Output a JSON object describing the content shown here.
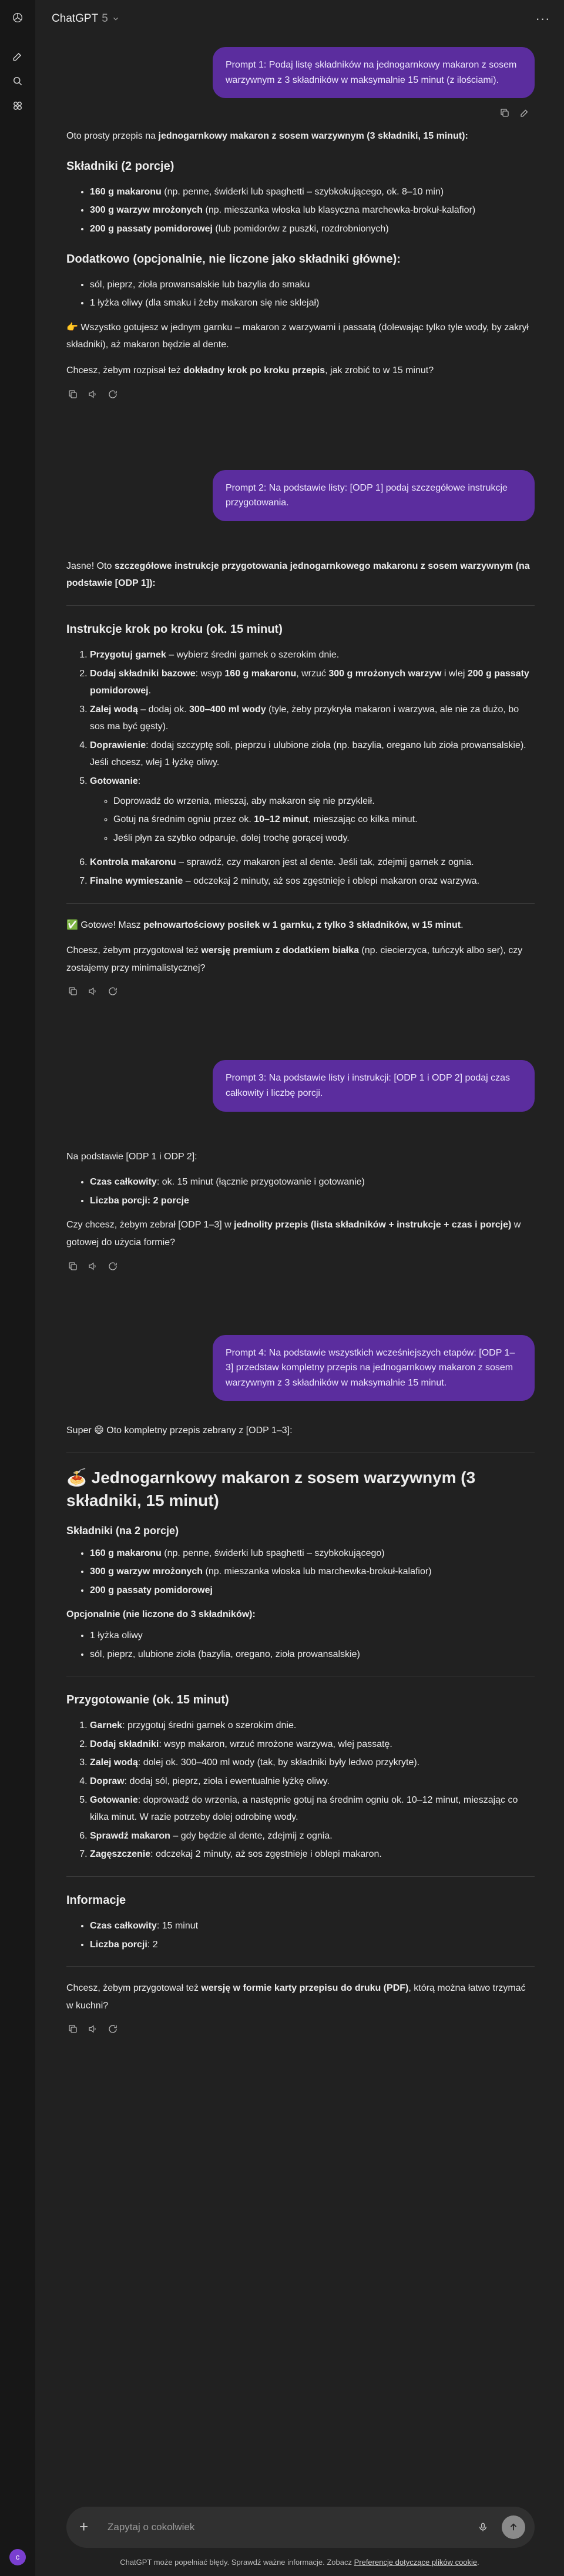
{
  "header": {
    "model_name": "ChatGPT",
    "model_version": "5"
  },
  "messages": {
    "p1": "Prompt 1: Podaj listę składników na jednogarnkowy makaron z sosem warzywnym z 3 składników w maksymalnie 15 minut (z ilościami).",
    "a1": {
      "intro_pre": "Oto prosty przepis na ",
      "intro_bold": "jednogarnkowy makaron z sosem warzywnym (3 składniki, 15 minut):",
      "h_ingredients": "Składniki (2 porcje)",
      "ing1_b": "160 g makaronu",
      "ing1_r": " (np. penne, świderki lub spaghetti – szybkokującego, ok. 8–10 min)",
      "ing2_b": "300 g warzyw mrożonych",
      "ing2_r": " (np. mieszanka włoska lub klasyczna marchewka-brokuł-kalafior)",
      "ing3_b": "200 g passaty pomidorowej",
      "ing3_r": " (lub pomidorów z puszki, rozdrobnionych)",
      "h_extra": "Dodatkowo (opcjonalnie, nie liczone jako składniki główne):",
      "extra1": "sól, pieprz, zioła prowansalskie lub bazylia do smaku",
      "extra2": "1 łyżka oliwy (dla smaku i żeby makaron się nie sklejał)",
      "note": "👉 Wszystko gotujesz w jednym garnku – makaron z warzywami i passatą (dolewając tylko tyle wody, by zakrył składniki), aż makaron będzie al dente.",
      "q_pre": "Chcesz, żebym rozpisał też ",
      "q_bold": "dokładny krok po kroku przepis",
      "q_post": ", jak zrobić to w 15 minut?"
    },
    "p2": "Prompt 2: Na podstawie listy: [ODP 1] podaj szczegółowe instrukcje przygotowania.",
    "a2": {
      "intro_pre": "Jasne! Oto ",
      "intro_bold": "szczegółowe instrukcje przygotowania jednogarnkowego makaronu z sosem warzywnym (na podstawie [ODP 1]):",
      "h_steps": "Instrukcje krok po kroku (ok. 15 minut)",
      "s1_b": "Przygotuj garnek",
      "s1_r": " – wybierz średni garnek o szerokim dnie.",
      "s2_b": "Dodaj składniki bazowe",
      "s2_r1": ": wsyp ",
      "s2_b2": "160 g makaronu",
      "s2_r2": ", wrzuć ",
      "s2_b3": "300 g mrożonych warzyw",
      "s2_r3": " i wlej ",
      "s2_b4": "200 g passaty pomidorowej",
      "s2_r4": ".",
      "s3_b": "Zalej wodą",
      "s3_r1": " – dodaj ok. ",
      "s3_b2": "300–400 ml wody",
      "s3_r2": " (tyle, żeby przykryła makaron i warzywa, ale nie za dużo, bo sos ma być gęsty).",
      "s4_b": "Doprawienie",
      "s4_r": ": dodaj szczyptę soli, pieprzu i ulubione zioła (np. bazylia, oregano lub zioła prowansalskie). Jeśli chcesz, wlej 1 łyżkę oliwy.",
      "s5_b": "Gotowanie",
      "s5_r": ":",
      "s5_sub1": "Doprowadź do wrzenia, mieszaj, aby makaron się nie przykleił.",
      "s5_sub2_pre": "Gotuj na średnim ogniu przez ok. ",
      "s5_sub2_b": "10–12 minut",
      "s5_sub2_post": ", mieszając co kilka minut.",
      "s5_sub3": "Jeśli płyn za szybko odparuje, dolej trochę gorącej wody.",
      "s6_b": "Kontrola makaronu",
      "s6_r": " – sprawdź, czy makaron jest al dente. Jeśli tak, zdejmij garnek z ognia.",
      "s7_b": "Finalne wymieszanie",
      "s7_r": " – odczekaj 2 minuty, aż sos zgęstnieje i oblepi makaron oraz warzywa.",
      "done_pre": "✅ Gotowe! Masz ",
      "done_bold": "pełnowartościowy posiłek w 1 garnku, z tylko 3 składników, w 15 minut",
      "done_post": ".",
      "q_pre": "Chcesz, żebym przygotował też ",
      "q_bold": "wersję premium z dodatkiem białka",
      "q_post": " (np. ciecierzyca, tuńczyk albo ser), czy zostajemy przy minimalistycznej?"
    },
    "p3": "Prompt 3: Na podstawie listy i instrukcji: [ODP 1 i ODP 2] podaj czas całkowity i liczbę porcji.",
    "a3": {
      "intro": "Na podstawie [ODP 1 i ODP 2]:",
      "t_b": "Czas całkowity",
      "t_r": ": ok. 15 minut (łącznie przygotowanie i gotowanie)",
      "p_b": "Liczba porcji: 2 porcje",
      "q_pre": "Czy chcesz, żebym zebrał [ODP 1–3] w ",
      "q_bold": "jednolity przepis (lista składników + instrukcje + czas i porcje)",
      "q_post": " w gotowej do użycia formie?"
    },
    "p4": "Prompt 4: Na podstawie wszystkich wcześniejszych etapów: [ODP 1–3] przedstaw kompletny przepis na jednogarnkowy makaron z sosem warzywnym z 3 składników w maksymalnie 15 minut.",
    "a4": {
      "intro": "Super 😄 Oto kompletny przepis zebrany z [ODP 1–3]:",
      "title": "🍝 Jednogarnkowy makaron z sosem warzywnym (3 składniki, 15 minut)",
      "h_ing": "Składniki (na 2 porcje)",
      "i1_b": "160 g makaronu",
      "i1_r": " (np. penne, świderki lub spaghetti – szybkokującego)",
      "i2_b": "300 g warzyw mrożonych",
      "i2_r": " (np. mieszanka włoska lub marchewka-brokuł-kalafior)",
      "i3_b": "200 g passaty pomidorowej",
      "h_opt": "Opcjonalnie (nie liczone do 3 składników):",
      "o1": "1 łyżka oliwy",
      "o2": "sól, pieprz, ulubione zioła (bazylia, oregano, zioła prowansalskie)",
      "h_prep": "Przygotowanie (ok. 15 minut)",
      "r1_b": "Garnek",
      "r1_r": ": przygotuj średni garnek o szerokim dnie.",
      "r2_b": "Dodaj składniki",
      "r2_r": ": wsyp makaron, wrzuć mrożone warzywa, wlej passatę.",
      "r3_b": "Zalej wodą",
      "r3_r": ": dolej ok. 300–400 ml wody (tak, by składniki były ledwo przykryte).",
      "r4_b": "Dopraw",
      "r4_r": ": dodaj sól, pieprz, zioła i ewentualnie łyżkę oliwy.",
      "r5_b": "Gotowanie",
      "r5_r": ": doprowadź do wrzenia, a następnie gotuj na średnim ogniu ok. 10–12 minut, mieszając co kilka minut. W razie potrzeby dolej odrobinę wody.",
      "r6_b": "Sprawdź makaron",
      "r6_r": " – gdy będzie al dente, zdejmij z ognia.",
      "r7_b": "Zagęszczenie",
      "r7_r": ": odczekaj 2 minuty, aż sos zgęstnieje i oblepi makaron.",
      "h_info": "Informacje",
      "f1_b": "Czas całkowity",
      "f1_r": ": 15 minut",
      "f2_b": "Liczba porcji",
      "f2_r": ": 2",
      "q_pre": "Chcesz, żebym przygotował też ",
      "q_bold": "wersję w formie karty przepisu do druku (PDF)",
      "q_post": ", którą można łatwo trzymać w kuchni?"
    }
  },
  "composer": {
    "placeholder": "Zapytaj o cokolwiek"
  },
  "footer": {
    "text": "ChatGPT może popełniać błędy. Sprawdź ważne informacje. Zobacz ",
    "link": "Preferencje dotyczące plików cookie",
    "end": "."
  },
  "avatar": {
    "initial": "c"
  },
  "colors": {
    "user_bubble": "#5b2d9e",
    "background": "#212121",
    "sidebar": "#171717"
  }
}
